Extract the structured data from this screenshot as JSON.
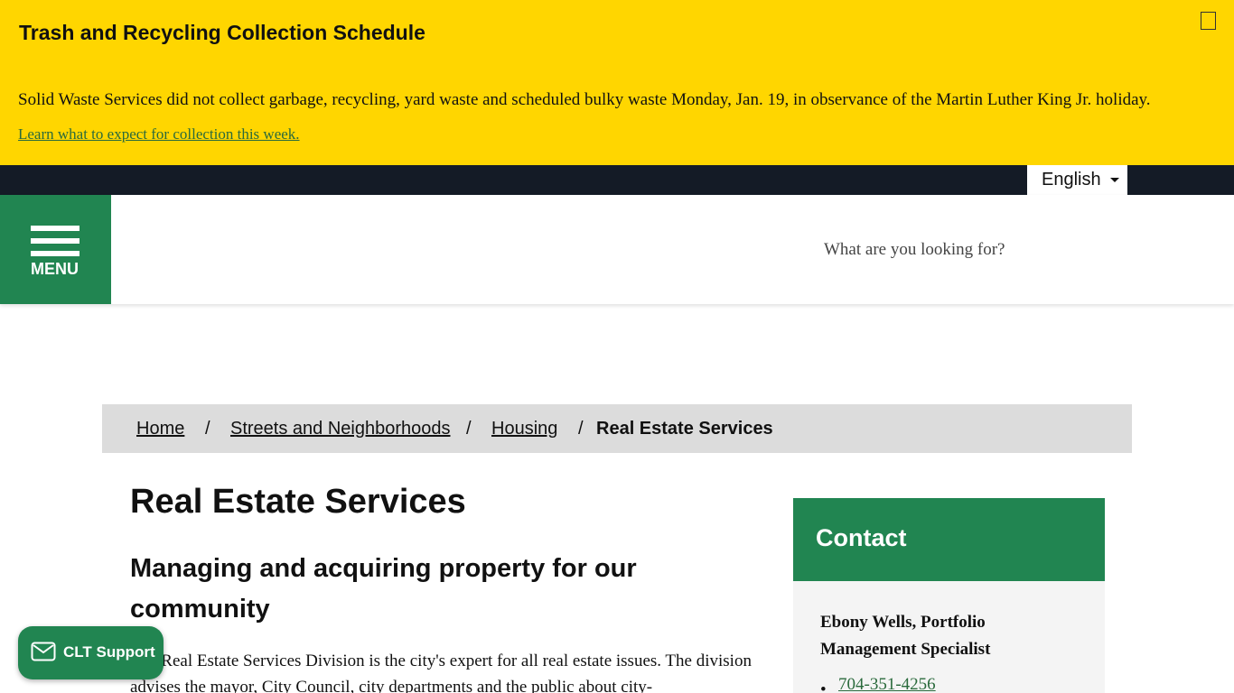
{
  "alert": {
    "title": "Trash and Recycling Collection Schedule",
    "body": "Solid Waste Services did not collect garbage, recycling, yard waste and scheduled bulky waste Monday, Jan. 19, in observance of the Martin Luther King Jr. holiday.",
    "link": "Learn what to expect for collection this week.",
    "close_icon": "close-icon"
  },
  "language": {
    "selected": "English"
  },
  "header": {
    "menu_label": "MENU",
    "search_placeholder": "What are you looking for?"
  },
  "breadcrumb": {
    "items": [
      "Home",
      "Streets and Neighborhoods",
      "Housing ",
      "Real Estate Services"
    ],
    "separator": "/"
  },
  "main": {
    "title": "Real Estate Services",
    "subheading": "Managing and acquiring property for our community",
    "intro": "The Real Estate Services Division is the city's expert for all real estate issues. The division advises the mayor, City Council, city departments and the public about city-"
  },
  "contact": {
    "title": "Contact",
    "name": "Ebony Wells, Portfolio Management Specialist",
    "bullet": "•",
    "phone": "704-351-4256"
  },
  "support": {
    "label": "CLT Support",
    "icon": "mail-icon"
  },
  "colors": {
    "alert_yellow": "#ffd600",
    "brand_green": "#218551",
    "dark_bar": "#141b26",
    "breadcrumb_bg": "#dcdcdc"
  }
}
